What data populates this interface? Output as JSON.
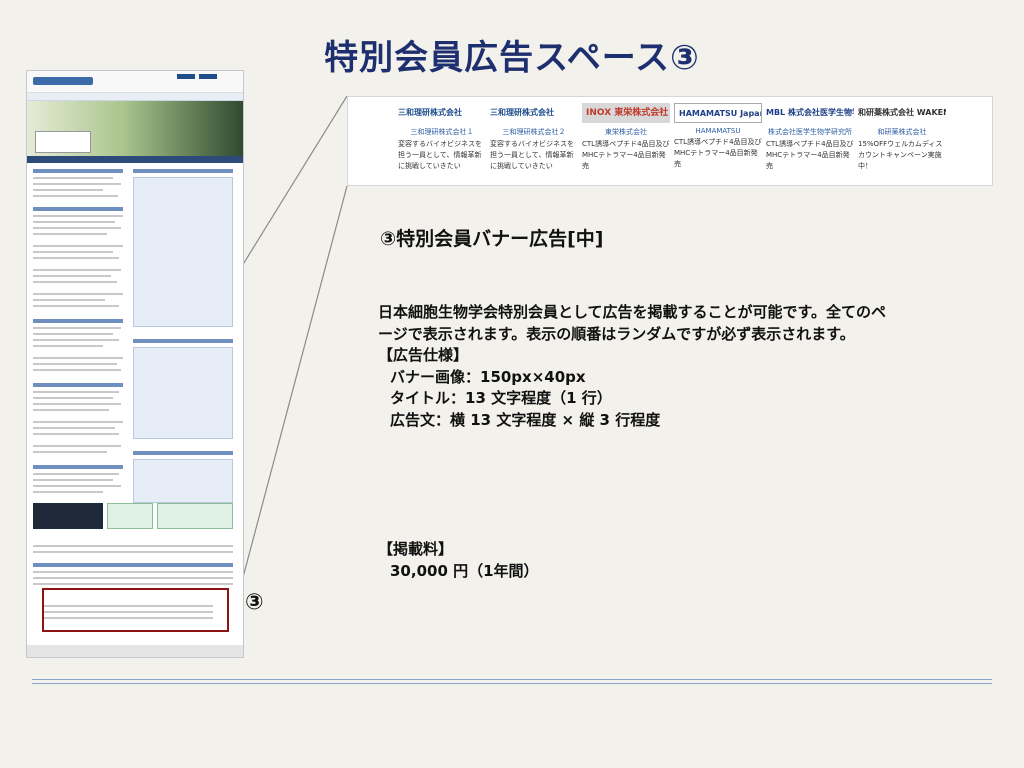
{
  "slide": {
    "title": "特別会員広告スペース③",
    "marker_label": "③"
  },
  "banner": {
    "items": [
      {
        "logo": "三和理研株式会社",
        "name": "三和理研株式会社１",
        "desc": "変容するバイオビジネスを担う一員として、情報革新に挑戦していきたい"
      },
      {
        "logo": "三和理研株式会社",
        "name": "三和理研株式会社２",
        "desc": "変容するバイオビジネスを担う一員として、情報革新に挑戦していきたい"
      },
      {
        "logo": "INOX 東栄株式会社",
        "name": "東栄株式会社",
        "desc": "CTL誘導ペプチド4品目及びMHCテトラマー4品目新発売"
      },
      {
        "logo": "HAMAMATSU Japan",
        "name": "HAMAMATSU",
        "desc": "CTL誘導ペプチド4品目及びMHCテトラマー4品目新発売"
      },
      {
        "logo": "MBL 株式会社医学生物学研究所",
        "name": "株式会社医学生物学研究所",
        "desc": "CTL誘導ペプチド4品目及びMHCテトラマー4品目新発売"
      },
      {
        "logo": "和研薬株式会社 WAKENYAKU CO.,LTD.",
        "name": "和研薬株式会社",
        "desc": "15%OFFウェルカムディスカウントキャンペーン実施中！"
      }
    ]
  },
  "content": {
    "subheading": "③特別会員バナー広告[中]",
    "description_line1": "日本細胞生物学会特別会員として広告を掲載することが可能です。全てのペ",
    "description_line2": "ージで表示されます。表示の順番はランダムですが必ず表示されます。",
    "spec_heading": "【広告仕様】",
    "spec_banner": "バナー画像：150px×40px",
    "spec_title": "タイトル：13 文字程度（1 行）",
    "spec_text": "広告文：横 13 文字程度 × 縦 3 行程度",
    "fee_heading": "【掲載料】",
    "fee_value": "30,000 円（1年間）"
  },
  "colors": {
    "title": "#1d2f6f",
    "highlight_border": "#8b1515",
    "background": "#f3f1ec"
  }
}
